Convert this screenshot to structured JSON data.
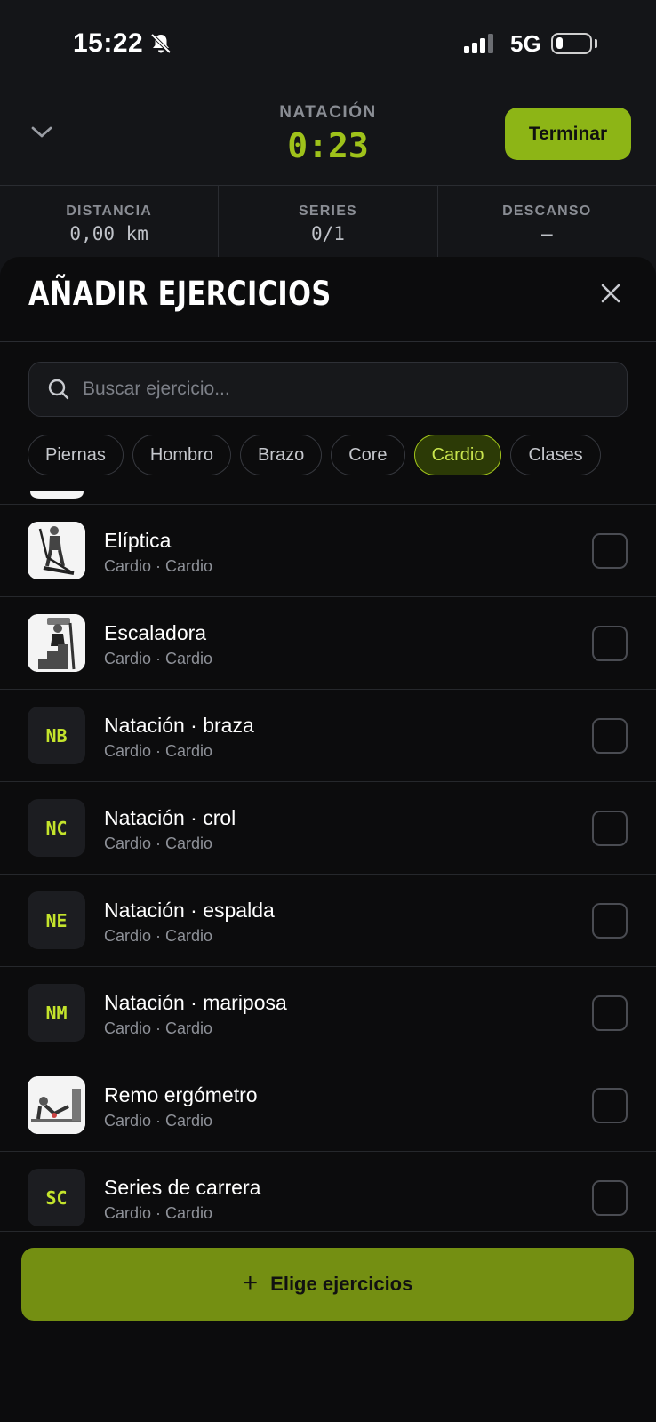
{
  "status_bar": {
    "time": "15:22",
    "network": "5G",
    "battery_level": 0.2
  },
  "workout": {
    "title": "NATACIÓN",
    "timer": "0:23",
    "finish_label": "Terminar"
  },
  "stats": [
    {
      "label": "DISTANCIA",
      "value": "0,00 km"
    },
    {
      "label": "SERIES",
      "value": "0/1"
    },
    {
      "label": "DESCANSO",
      "value": "—"
    }
  ],
  "sheet": {
    "title": "AÑADIR EJERCICIOS",
    "search_placeholder": "Buscar ejercicio...",
    "chips": [
      {
        "label": "Piernas",
        "active": false
      },
      {
        "label": "Hombro",
        "active": false
      },
      {
        "label": "Brazo",
        "active": false
      },
      {
        "label": "Core",
        "active": false
      },
      {
        "label": "Cardio",
        "active": true
      },
      {
        "label": "Clases",
        "active": false
      }
    ],
    "exercises": [
      {
        "name": "Elíptica",
        "subtitle": "Cardio · Cardio",
        "thumb": "elliptical-image",
        "initials": "",
        "checked": false
      },
      {
        "name": "Escaladora",
        "subtitle": "Cardio · Cardio",
        "thumb": "stair-climber-image",
        "initials": "",
        "checked": false
      },
      {
        "name": "Natación · braza",
        "subtitle": "Cardio · Cardio",
        "thumb": "initials",
        "initials": "NB",
        "checked": false
      },
      {
        "name": "Natación · crol",
        "subtitle": "Cardio · Cardio",
        "thumb": "initials",
        "initials": "NC",
        "checked": false
      },
      {
        "name": "Natación · espalda",
        "subtitle": "Cardio · Cardio",
        "thumb": "initials",
        "initials": "NE",
        "checked": false
      },
      {
        "name": "Natación · mariposa",
        "subtitle": "Cardio · Cardio",
        "thumb": "initials",
        "initials": "NM",
        "checked": false
      },
      {
        "name": "Remo ergómetro",
        "subtitle": "Cardio · Cardio",
        "thumb": "rowing-image",
        "initials": "",
        "checked": false
      },
      {
        "name": "Series de carrera",
        "subtitle": "Cardio · Cardio",
        "thumb": "initials",
        "initials": "SC",
        "checked": false
      }
    ],
    "cta_label": "Elige ejercicios"
  },
  "colors": {
    "accent": "#9fc21a",
    "button": "#8db516",
    "cta": "#748f12",
    "background": "#141518",
    "sheet": "#0c0c0d"
  }
}
